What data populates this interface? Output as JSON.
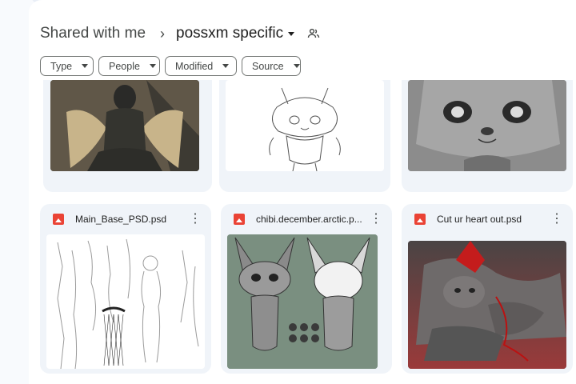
{
  "breadcrumb": {
    "root": "Shared with me",
    "separator": "›",
    "current": "possxm specific"
  },
  "filters": [
    {
      "label": "Type"
    },
    {
      "label": "People"
    },
    {
      "label": "Modified"
    },
    {
      "label": "Source"
    }
  ],
  "files": [
    {
      "name": "Main_Base_PSD.psd",
      "icon": "image-file-icon"
    },
    {
      "name": "chibi.december.arctic.p...",
      "icon": "image-file-icon"
    },
    {
      "name": "Cut ur heart out.psd",
      "icon": "image-file-icon"
    }
  ],
  "more_glyph": "⋮",
  "colors": {
    "file_icon": "#ea4335",
    "card_bg": "#f0f4f9",
    "page_bg": "#f8fafd"
  }
}
